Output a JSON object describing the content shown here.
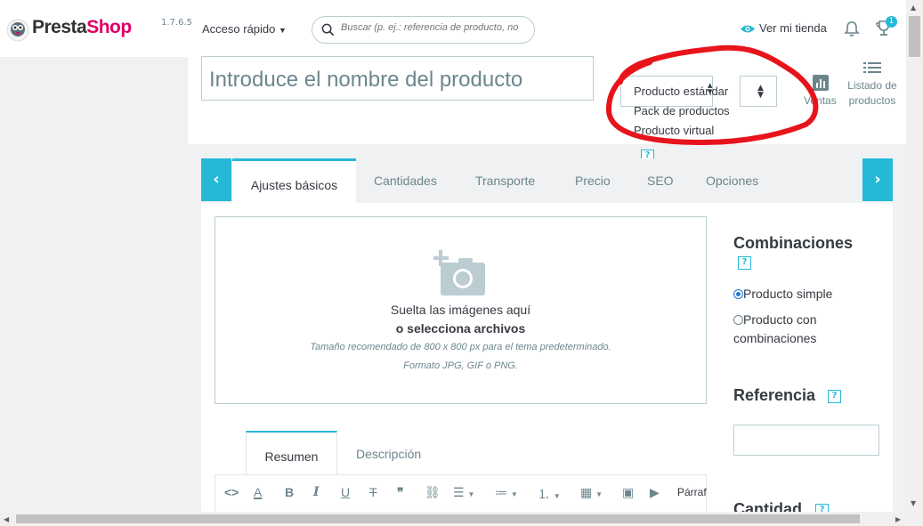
{
  "header": {
    "logo_prefix": "Presta",
    "logo_suffix": "Shop",
    "version": "1.7.6.5",
    "quick_access": "Acceso rápido",
    "search_placeholder": "Buscar (p. ej.: referencia de producto, no",
    "view_store": "Ver mi tienda",
    "notifications_badge": "1"
  },
  "product": {
    "name_placeholder": "Introduce el nombre del producto",
    "type_selected": "Producto estándar",
    "type_options": [
      "Pack de productos",
      "Producto virtual"
    ],
    "help": "?",
    "ventas": "Ventas",
    "listado": "Listado de productos"
  },
  "tabs": {
    "items": [
      "Ajustes básicos",
      "Cantidades",
      "Transporte",
      "Precio",
      "SEO",
      "Opciones"
    ],
    "prev": "‹",
    "next": "›"
  },
  "dropzone": {
    "line1": "Suelta las imágenes aquí",
    "line2": "o selecciona archivos",
    "line3": "Tamaño recomendado de 800 x 800 px para el tema predeterminado.",
    "line4": "Formato JPG, GIF o PNG."
  },
  "editor": {
    "subtabs": [
      "Resumen",
      "Descripción"
    ],
    "format_label": "Párrafo"
  },
  "sidebar_right": {
    "combinations_title": "Combinaciones",
    "option_simple": "Producto simple",
    "option_comb_line1": "Producto con",
    "option_comb_line2": "combinaciones",
    "reference_title": "Referencia",
    "quantity_title": "Cantidad"
  },
  "colors": {
    "accent": "#25b9d7",
    "brand_pink": "#df0067",
    "annotation_red": "#e8141c"
  }
}
